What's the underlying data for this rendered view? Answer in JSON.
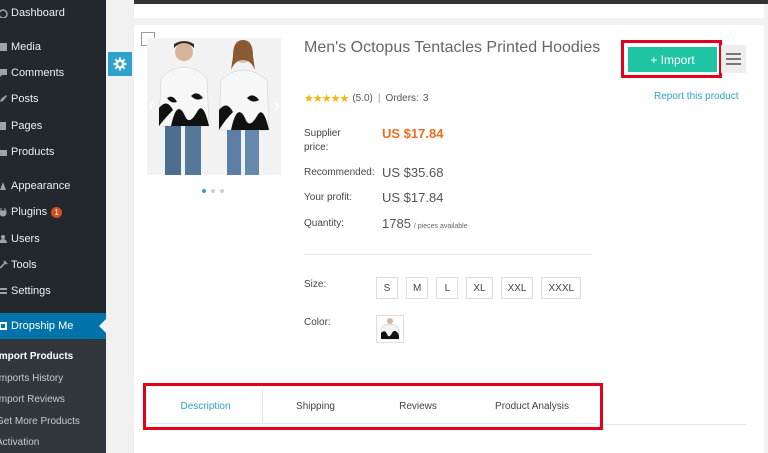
{
  "sidebar": {
    "items": [
      {
        "label": "Dashboard",
        "icon": "dashboard-icon"
      },
      {
        "label": "Media",
        "icon": "media-icon"
      },
      {
        "label": "Comments",
        "icon": "comments-icon"
      },
      {
        "label": "Posts",
        "icon": "posts-icon"
      },
      {
        "label": "Pages",
        "icon": "pages-icon"
      },
      {
        "label": "Products",
        "icon": "products-icon"
      },
      {
        "label": "Appearance",
        "icon": "appearance-icon"
      },
      {
        "label": "Plugins",
        "icon": "plugins-icon",
        "badge": "1"
      },
      {
        "label": "Users",
        "icon": "users-icon"
      },
      {
        "label": "Tools",
        "icon": "tools-icon"
      },
      {
        "label": "Settings",
        "icon": "settings-icon"
      },
      {
        "label": "Dropship Me",
        "icon": "dropship-icon"
      }
    ],
    "submenu": [
      {
        "label": "Import Products",
        "active": true
      },
      {
        "label": "Imports History"
      },
      {
        "label": "Import Reviews"
      },
      {
        "label": "Get More Products"
      },
      {
        "label": "Activation"
      }
    ]
  },
  "product": {
    "title": "Men's Octopus Tentacles Printed Hoodies",
    "rating_value": "(5.0)",
    "orders_label": "Orders:",
    "orders_count": "3",
    "supplier_price_label": "Supplier price:",
    "supplier_price": "US $17.84",
    "recommended_label": "Recommended:",
    "recommended_price": "US $35.68",
    "profit_label": "Your profit:",
    "profit": "US $17.84",
    "quantity_label": "Quantity:",
    "quantity": "1785",
    "quantity_suffix": "/ pieces available",
    "size_label": "Size:",
    "sizes": [
      "S",
      "M",
      "L",
      "XL",
      "XXL",
      "XXXL"
    ],
    "color_label": "Color:"
  },
  "actions": {
    "import_label": "+ Import",
    "report_label": "Report this product"
  },
  "tabs": [
    {
      "label": "Description",
      "active": true
    },
    {
      "label": "Shipping"
    },
    {
      "label": "Reviews"
    },
    {
      "label": "Product Analysis"
    }
  ],
  "colors": {
    "sidebar_bg": "#23282d",
    "active_menu": "#0073aa",
    "import_button": "#1fc5a2",
    "price_accent": "#ef6c1a",
    "link": "#2ea2cc",
    "highlight": "#e3001b"
  }
}
